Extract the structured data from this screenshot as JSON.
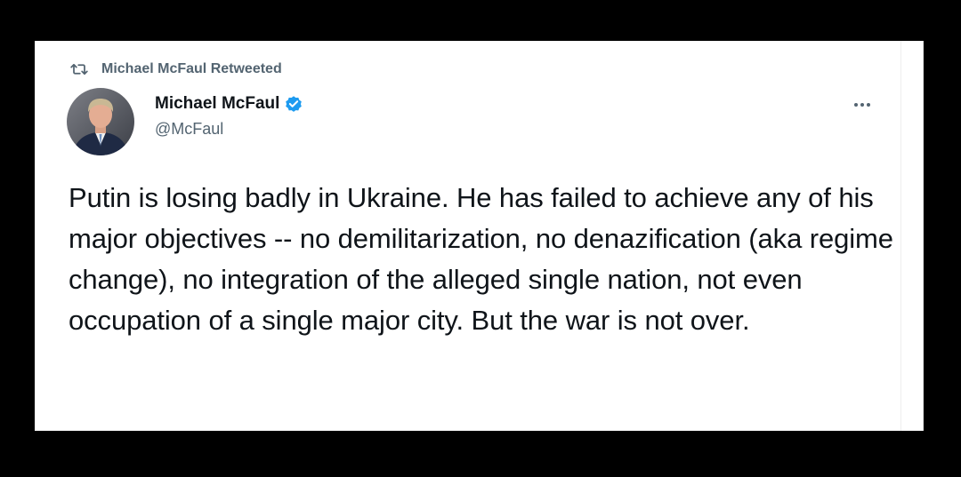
{
  "retweet": {
    "icon": "retweet-icon",
    "text": "Michael McFaul Retweeted"
  },
  "author": {
    "name": "Michael McFaul",
    "handle": "@McFaul",
    "verified": true,
    "verified_color": "#1d9bf0",
    "avatar": "avatar-photo"
  },
  "more": {
    "icon": "more-icon",
    "label": "..."
  },
  "tweet": {
    "text": "Putin is losing badly in Ukraine. He has failed to achieve any of his major objectives -- no demilitarization, no denazification (aka regime change), no integration of the alleged single nation, not even occupation of a single major city. But the war is not over."
  },
  "colors": {
    "background": "#000000",
    "card": "#ffffff",
    "primary_text": "#0f1419",
    "secondary_text": "#536471"
  }
}
